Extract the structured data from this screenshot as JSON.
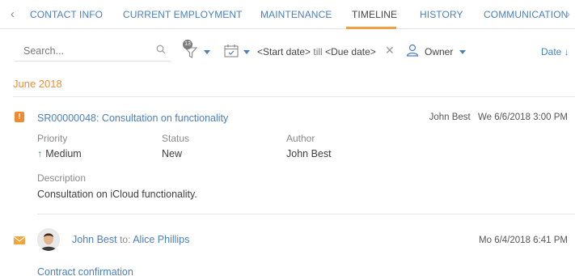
{
  "tabs": {
    "items": [
      {
        "label": "CONTACT INFO"
      },
      {
        "label": "CURRENT EMPLOYMENT"
      },
      {
        "label": "MAINTENANCE"
      },
      {
        "label": "TIMELINE"
      },
      {
        "label": "HISTORY"
      },
      {
        "label": "COMMUNICATION"
      }
    ],
    "active": "TIMELINE"
  },
  "filters": {
    "search_placeholder": "Search...",
    "filter_badge": "13",
    "start_date": "<Start date>",
    "till": "till",
    "due_date": "<Due date>",
    "owner_label": "Owner",
    "sort_label": "Date ↓"
  },
  "timeline": {
    "month": "June 2018",
    "items": [
      {
        "type": "case",
        "title": "SR00000048: Consultation on functionality",
        "owner": "John Best",
        "datetime": "We 6/6/2018 3:00 PM",
        "fields": {
          "priority_label": "Priority",
          "priority_value": "Medium",
          "status_label": "Status",
          "status_value": "New",
          "author_label": "Author",
          "author_value": "John Best",
          "description_label": "Description",
          "description_value": "Consultation on iCloud functionality."
        }
      },
      {
        "type": "email",
        "sender": "John Best",
        "to_label": "to:",
        "recipient": "Alice Phillips",
        "datetime": "Mo 6/4/2018 6:41 PM",
        "subject": "Contract confirmation"
      }
    ]
  },
  "colors": {
    "accent_link": "#4a7fc1",
    "active_tab_underline": "#f0a040",
    "month_header": "#e8913a",
    "case_icon": "#f08a2c",
    "priority_arrow": "#3aa657"
  },
  "icons": [
    "chevron-left-icon",
    "chevron-right-icon",
    "search-icon",
    "filter-icon",
    "calendar-icon",
    "clear-icon",
    "user-icon",
    "case-icon",
    "email-icon"
  ]
}
